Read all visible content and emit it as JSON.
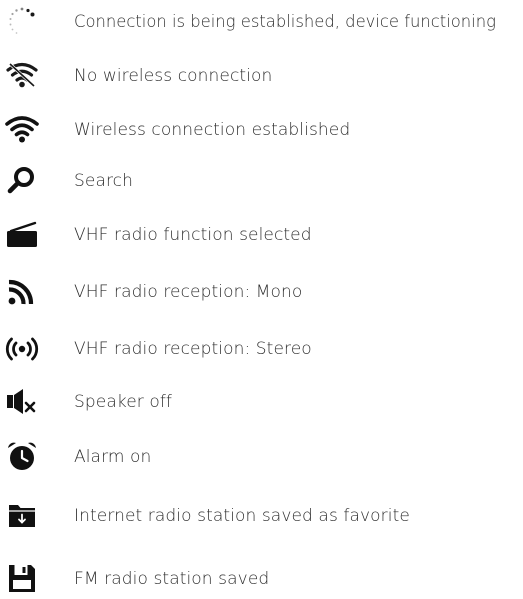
{
  "legend": {
    "items": [
      {
        "icon": "loading-spinner-icon",
        "label": "Connection is being established, device functioning"
      },
      {
        "icon": "wifi-off-icon",
        "label": "No wireless connection"
      },
      {
        "icon": "wifi-icon",
        "label": "Wireless connection established"
      },
      {
        "icon": "search-icon",
        "label": "Search"
      },
      {
        "icon": "radio-icon",
        "label": "VHF radio function selected"
      },
      {
        "icon": "rss-mono-icon",
        "label": "VHF radio reception: Mono"
      },
      {
        "icon": "broadcast-stereo-icon",
        "label": "VHF radio reception: Stereo"
      },
      {
        "icon": "speaker-off-icon",
        "label": "Speaker off"
      },
      {
        "icon": "alarm-clock-icon",
        "label": "Alarm on"
      },
      {
        "icon": "folder-download-icon",
        "label": "Internet radio station saved as favorite"
      },
      {
        "icon": "floppy-disk-icon",
        "label": "FM radio station saved"
      }
    ]
  }
}
